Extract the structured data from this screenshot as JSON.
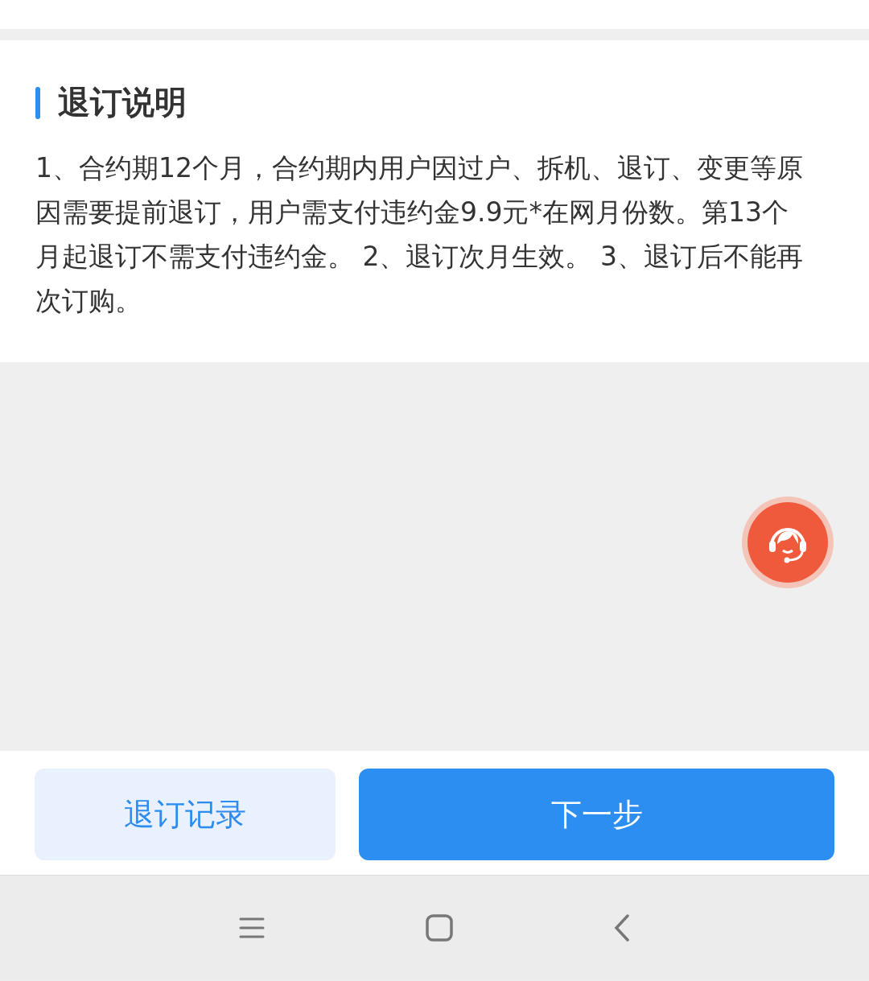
{
  "section": {
    "title": "退订说明",
    "body": "1、合约期12个月，合约期内用户因过户、拆机、退订、变更等原因需要提前退订，用户需支付违约金9.9元*在网月份数。第13个月起退订不需支付违约金。 2、退订次月生效。 3、退订后不能再次订购。"
  },
  "buttons": [
    {
      "label": "退订记录",
      "kind": "secondary"
    },
    {
      "label": "下一步",
      "kind": "primary"
    }
  ]
}
